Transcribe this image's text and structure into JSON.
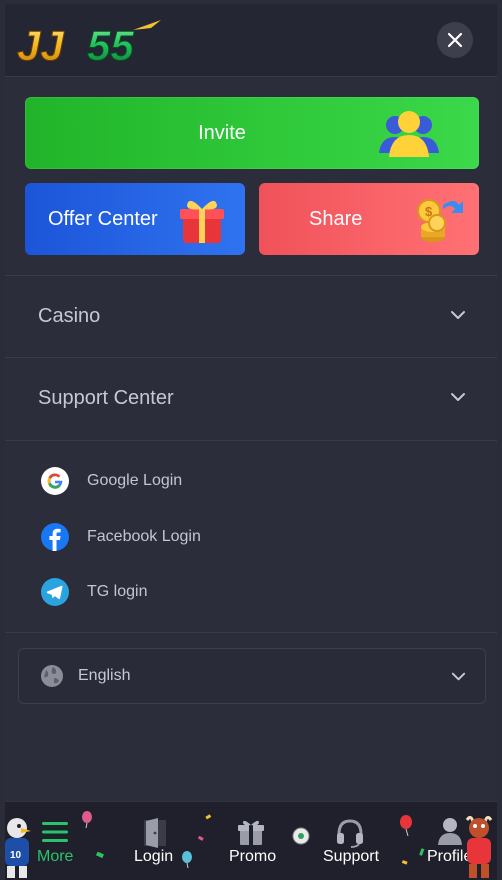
{
  "header": {
    "logo_text": "JJ55",
    "close_icon": "close-icon"
  },
  "promo": {
    "invite_label": "Invite",
    "offer_label": "Offer Center",
    "share_label": "Share"
  },
  "menu": {
    "casino_label": "Casino",
    "support_label": "Support Center"
  },
  "logins": [
    {
      "label": "Google Login",
      "icon": "google-icon"
    },
    {
      "label": "Facebook Login",
      "icon": "facebook-icon"
    },
    {
      "label": "TG login",
      "icon": "telegram-icon"
    }
  ],
  "language": {
    "selected": "English",
    "icon": "globe-icon"
  },
  "bottom_nav": [
    {
      "label": "More",
      "icon": "menu-icon",
      "active": true
    },
    {
      "label": "Login",
      "icon": "door-icon"
    },
    {
      "label": "Promo",
      "icon": "gift-icon"
    },
    {
      "label": "Support",
      "icon": "headset-icon"
    },
    {
      "label": "Profile",
      "icon": "user-icon"
    }
  ],
  "colors": {
    "background": "#2b2d3b",
    "invite_green": "#2fc93a",
    "offer_blue": "#2f73f0",
    "share_red": "#ff6b70",
    "active_nav": "#28c46a"
  }
}
